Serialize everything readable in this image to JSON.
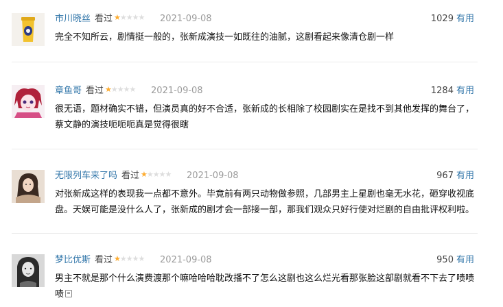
{
  "reviews": [
    {
      "user": "市川晓丝",
      "rated_label": "看过",
      "rating": 1,
      "max_rating": 5,
      "date": "2021-09-08",
      "votes": "1029",
      "useful_label": "有用",
      "avatar": "yellow-cup-avatar",
      "content": "完全不知所云，剧情挺一般的，张新成演技一如既往的油腻，这剧看起来像清仓剧一样"
    },
    {
      "user": "章鱼哥",
      "rated_label": "看过",
      "rating": 1,
      "max_rating": 5,
      "date": "2021-09-08",
      "votes": "1284",
      "useful_label": "有用",
      "avatar": "anime-girl-avatar",
      "content": "很无语，题材确实不错，但演员真的好不合适，张新成的长相除了校园剧实在是找不到其他发挥的舞台了，蔡文静的演技呃呃呃真是觉得很瞎"
    },
    {
      "user": "无限列车来了吗",
      "rated_label": "看过",
      "rating": 1,
      "max_rating": 5,
      "date": "2021-09-08",
      "votes": "967",
      "useful_label": "有用",
      "avatar": "woman-photo-avatar",
      "content": "对张新成这样的表现我一点都不意外。毕竟前有两只动物做参照，几部男主上星剧也毫无水花，砸穿收视底盘。天娱可能是没什么人了，张新成的剧才会一部接一部，那我们观众只好行使对烂剧的自由批评权利啦。"
    },
    {
      "user": "梦比优斯",
      "rated_label": "看过",
      "rating": 1,
      "max_rating": 5,
      "date": "2021-09-08",
      "votes": "950",
      "useful_label": "有用",
      "avatar": "bw-portrait-avatar",
      "content": "男主不就是那个什么演费渡那个嘛哈哈哈耽改播不了怎么这剧也这么烂光看那张脸这部剧就看不下去了啧啧啧"
    }
  ],
  "colors": {
    "link": "#3377aa",
    "star": "#ffac2d",
    "date": "#9b9b9b"
  }
}
